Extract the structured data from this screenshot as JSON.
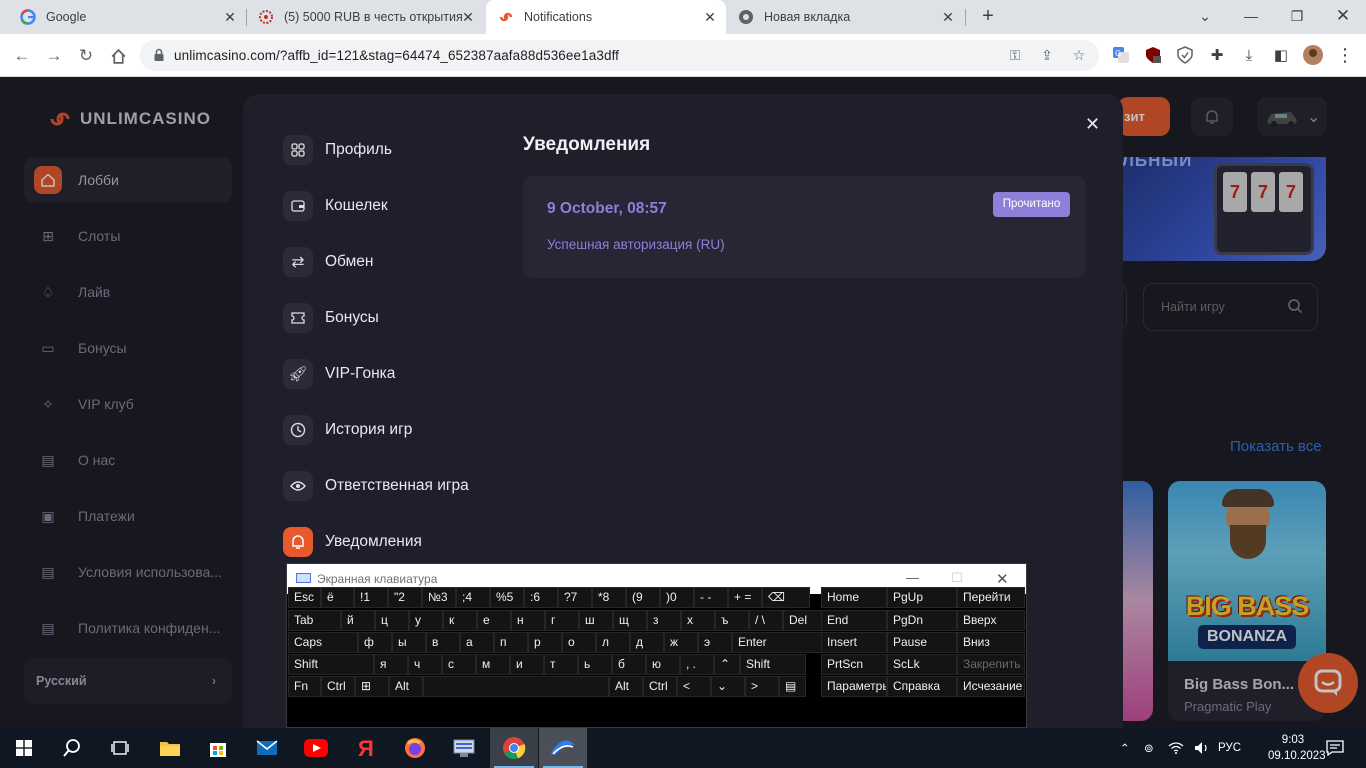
{
  "browser": {
    "tabs": [
      {
        "title": "Google",
        "icon": "google-icon"
      },
      {
        "title": "(5) 5000 RUB в честь открытия «",
        "icon": "tab-favicon-icon"
      },
      {
        "title": "Notifications",
        "icon": "unlim-icon"
      },
      {
        "title": "Новая вкладка",
        "icon": "chrome-icon"
      }
    ],
    "url": "unlimcasino.com/?affb_id=121&stag=64474_652387aafa88d536ee1a3dff"
  },
  "site": {
    "logo": "UNLIMCASINO",
    "sidebar": [
      {
        "label": "Лобби",
        "icon": "home-icon",
        "active": true
      },
      {
        "label": "Слоты",
        "icon": "grid-icon"
      },
      {
        "label": "Лайв",
        "icon": "spade-icon"
      },
      {
        "label": "Бонусы",
        "icon": "ticket-icon"
      },
      {
        "label": "VIP клуб",
        "icon": "sparkle-icon"
      },
      {
        "label": "О нас",
        "icon": "document-icon"
      },
      {
        "label": "Платежи",
        "icon": "wallet-icon"
      },
      {
        "label": "Условия использова...",
        "icon": "document-icon"
      },
      {
        "label": "Политика конфиден...",
        "icon": "document-icon"
      }
    ],
    "language": "Русский",
    "deposit_button": "зит",
    "banner_text": "ЛЬНЫЙ",
    "search_placeholder": "Найти игру",
    "show_all": "Показать все",
    "game": {
      "title": "BIG BASS",
      "subtitle": "BONANZA",
      "name": "Big Bass Bon...",
      "provider": "Pragmatic Play"
    }
  },
  "modal": {
    "menu": [
      {
        "label": "Профиль",
        "icon": "grid-icon"
      },
      {
        "label": "Кошелек",
        "icon": "wallet-icon"
      },
      {
        "label": "Обмен",
        "icon": "exchange-icon"
      },
      {
        "label": "Бонусы",
        "icon": "ticket-icon"
      },
      {
        "label": "VIP-Гонка",
        "icon": "rocket-icon"
      },
      {
        "label": "История игр",
        "icon": "clock-icon"
      },
      {
        "label": "Ответственная игра",
        "icon": "eye-icon"
      },
      {
        "label": "Уведомления",
        "icon": "bell-icon",
        "active": true
      }
    ],
    "title": "Уведомления",
    "notification": {
      "date": "9 October, 08:57",
      "message": "Успешная авторизация (RU)",
      "badge": "Прочитано"
    }
  },
  "osk": {
    "title": "Экранная клавиатура",
    "row1": [
      "Esc",
      "ё",
      "!1",
      "\"2",
      "№3",
      ";4",
      "%5",
      ":6",
      "?7",
      "*8",
      "(9",
      ")0",
      "- -",
      "+ =",
      "⌫"
    ],
    "row2": [
      "Tab",
      "й",
      "ц",
      "у",
      "к",
      "е",
      "н",
      "г",
      "ш",
      "щ",
      "з",
      "х",
      "ъ",
      "/ \\",
      "Del"
    ],
    "row3": [
      "Caps",
      "ф",
      "ы",
      "в",
      "а",
      "п",
      "р",
      "о",
      "л",
      "д",
      "ж",
      "э",
      "Enter"
    ],
    "row4": [
      "Shift",
      "я",
      "ч",
      "с",
      "м",
      "и",
      "т",
      "ь",
      "б",
      "ю",
      ", .",
      "⌃",
      "Shift"
    ],
    "row5": [
      "Fn",
      "Ctrl",
      "⊞",
      "Alt",
      "",
      "Alt",
      "Ctrl",
      "<",
      "⌄",
      ">",
      "▤"
    ],
    "nav": [
      "Home",
      "PgUp",
      "Перейти",
      "End",
      "PgDn",
      "Вверх",
      "Insert",
      "Pause",
      "Вниз",
      "PrtScn",
      "ScLk",
      "Закрепить",
      "Параметры",
      "Справка",
      "Исчезание"
    ]
  },
  "taskbar": {
    "lang": "РУС",
    "time": "9:03",
    "date": "09.10.2023"
  }
}
